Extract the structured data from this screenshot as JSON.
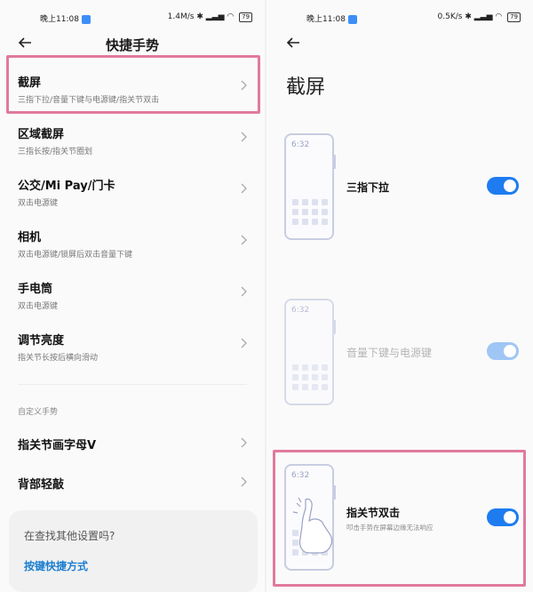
{
  "left": {
    "status": {
      "time": "晚上11:08",
      "net": "1.4M/s",
      "battery": "79"
    },
    "title": "快捷手势",
    "items": [
      {
        "title": "截屏",
        "sub": "三指下拉/音量下键与电源键/指关节双击"
      },
      {
        "title": "区域截屏",
        "sub": "三指长按/指关节圈划"
      },
      {
        "title": "公交/Mi Pay/门卡",
        "sub": "双击电源键"
      },
      {
        "title": "相机",
        "sub": "双击电源键/锁屏后双击音量下键"
      },
      {
        "title": "手电筒",
        "sub": "双击电源键"
      },
      {
        "title": "调节亮度",
        "sub": "指关节长按后横向滑动"
      }
    ],
    "section_label": "自定义手势",
    "custom_items": [
      {
        "title": "指关节画字母V"
      },
      {
        "title": "背部轻敲"
      }
    ],
    "info_card": {
      "question": "在查找其他设置吗?",
      "link": "按键快捷方式"
    }
  },
  "right": {
    "status": {
      "time": "晚上11:08",
      "net": "0.5K/s",
      "battery": "79"
    },
    "title": "截屏",
    "options": [
      {
        "phone_time": "6:32",
        "label": "三指下拉",
        "enabled": true
      },
      {
        "phone_time": "6:32",
        "label": "音量下键与电源键",
        "enabled": true,
        "disabled": true
      },
      {
        "phone_time": "6:32",
        "label": "指关节双击",
        "sub": "叩击手势在屏幕边缘无法响应",
        "enabled": true
      }
    ]
  },
  "colors": {
    "accent": "#1e7cf0",
    "highlight": "#e07a9c",
    "link": "#1b7ed1"
  }
}
